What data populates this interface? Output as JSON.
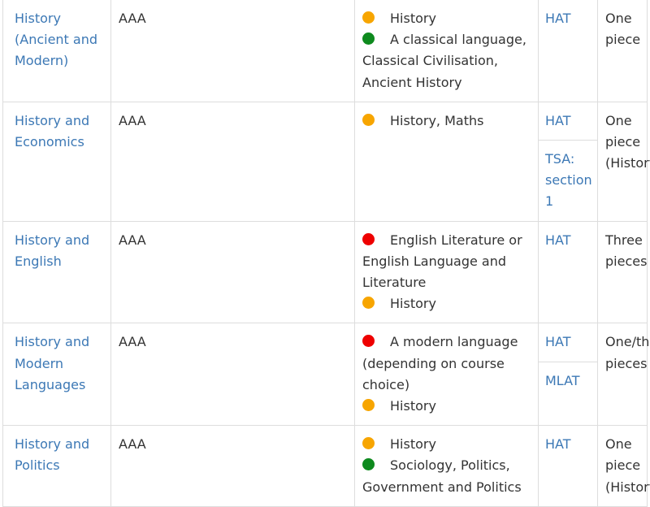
{
  "colors": {
    "amber": "#f7a500",
    "green": "#0e8a1e",
    "red": "#ee0000",
    "link": "#3c78b5"
  },
  "rows": [
    {
      "course": "History (Ancient and Modern)",
      "grades": "AAA",
      "subjects": [
        {
          "level": "amber",
          "text": "History"
        },
        {
          "level": "green",
          "text": "A classical language, Classical Civilisation, Ancient History"
        }
      ],
      "tests": [
        "HAT"
      ],
      "work": "One piece"
    },
    {
      "course": "History and Economics",
      "grades": "AAA",
      "subjects": [
        {
          "level": "amber",
          "text": "History, Maths"
        }
      ],
      "tests": [
        "HAT",
        "TSA: section 1"
      ],
      "work": "One piece (History)"
    },
    {
      "course": "History and English",
      "grades": "AAA",
      "subjects": [
        {
          "level": "red",
          "text": "English Literature or English Language and Literature"
        },
        {
          "level": "amber",
          "text": "History"
        }
      ],
      "tests": [
        "HAT"
      ],
      "work": "Three pieces"
    },
    {
      "course": "History and Modern Languages",
      "grades": "AAA",
      "subjects": [
        {
          "level": "red",
          "text": "A modern language (depending on course choice)"
        },
        {
          "level": "amber",
          "text": "History"
        }
      ],
      "tests": [
        "HAT",
        "MLAT"
      ],
      "work": "One/three pieces"
    },
    {
      "course": "History and Politics",
      "grades": "AAA",
      "subjects": [
        {
          "level": "amber",
          "text": "History"
        },
        {
          "level": "green",
          "text": "Sociology, Politics, Government and Politics"
        }
      ],
      "tests": [
        "HAT"
      ],
      "work": "One piece (History)"
    }
  ]
}
